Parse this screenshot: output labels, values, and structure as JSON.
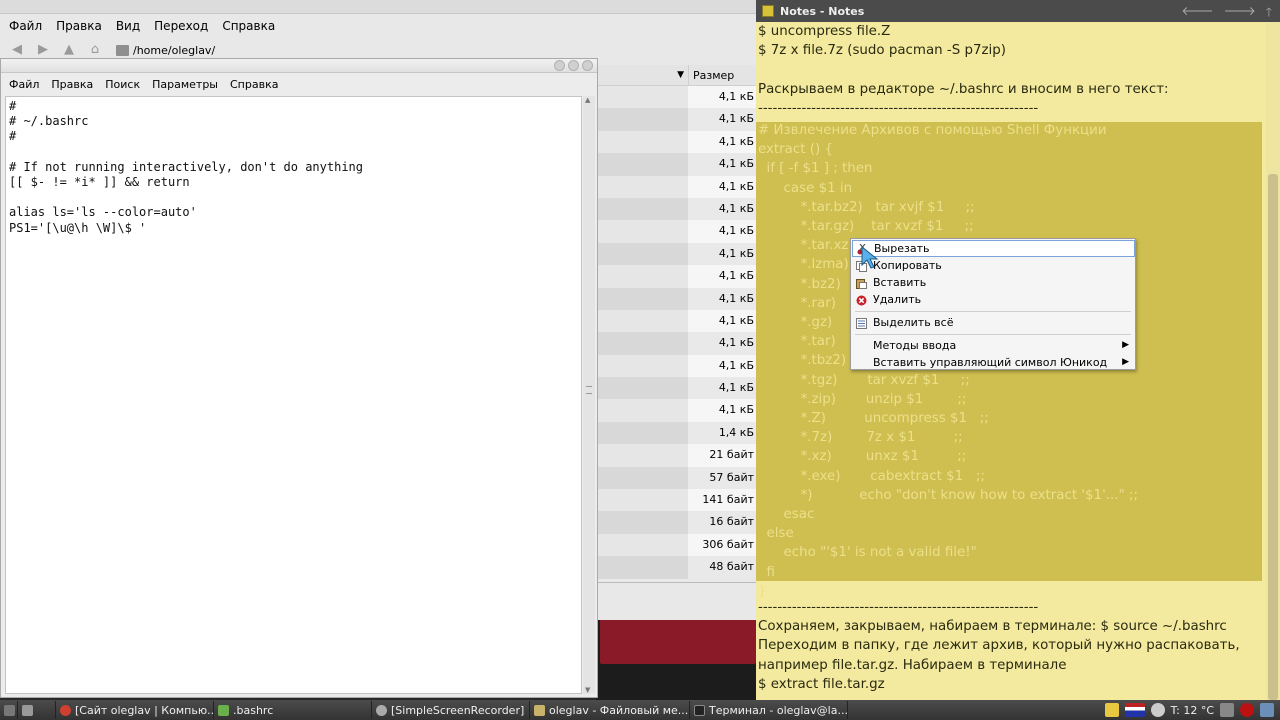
{
  "file_manager": {
    "menu": [
      "Файл",
      "Правка",
      "Вид",
      "Переход",
      "Справка"
    ],
    "path": "/home/oleglav/",
    "size_header": "Размер",
    "sizes": [
      "4,1 кБ",
      "4,1 кБ",
      "4,1 кБ",
      "4,1 кБ",
      "4,1 кБ",
      "4,1 кБ",
      "4,1 кБ",
      "4,1 кБ",
      "4,1 кБ",
      "4,1 кБ",
      "4,1 кБ",
      "4,1 кБ",
      "4,1 кБ",
      "4,1 кБ",
      "4,1 кБ",
      "1,4 кБ",
      "21 байт",
      "57 байт",
      "141 байт",
      "16 байт",
      "306 байт",
      "48 байт"
    ]
  },
  "editor": {
    "menu": [
      "Файл",
      "Правка",
      "Поиск",
      "Параметры",
      "Справка"
    ],
    "content": "#\n# ~/.bashrc\n#\n\n# If not running interactively, don't do anything\n[[ $- != *i* ]] && return\n\nalias ls='ls --color=auto'\nPS1='[\\u@\\h \\W]\\$ '"
  },
  "notes": {
    "title": "Notes - Notes",
    "lines_before": [
      "$ uncompress file.Z",
      "$ 7z x file.7z (sudo pacman -S p7zip)",
      "",
      "Раскрываем в редакторе ~/.bashrc и вносим в него текст:",
      "----------------------------------------------------------"
    ],
    "selected_lines": [
      "# Извлечение Архивов с помощью Shell Функции",
      "extract () {",
      "  if [ -f $1 ] ; then",
      "      case $1 in",
      "          *.tar.bz2)   tar xvjf $1     ;;",
      "          *.tar.gz)    tar xvzf $1     ;;",
      "          *.tar.xz)    tar xvJf $1     ;;",
      "          *.lzma)      unlzma $1       ;;",
      "          *.bz2)       bunzip2 $1      ;;",
      "          *.rar)       unrar x $1      ;;",
      "          *.gz)        gunzip $1       ;;",
      "          *.tar)       tar xvf $1      ;;",
      "          *.tbz2)      tar xvjf $1     ;;",
      "          *.tgz)       tar xvzf $1     ;;",
      "          *.zip)       unzip $1        ;;",
      "          *.Z)         uncompress $1   ;;",
      "          *.7z)        7z x $1         ;;",
      "          *.xz)        unxz $1         ;;",
      "          *.exe)       cabextract $1   ;;",
      "          *)           echo \"don't know how to extract '$1'...\" ;;",
      "      esac",
      "  else",
      "      echo \"'$1' is not a valid file!\"",
      "  fi",
      "}"
    ],
    "lines_after": [
      "----------------------------------------------------------",
      "Сохраняем, закрываем, набираем в терминале: $ source ~/.bashrc",
      "Переходим в папку, где лежит архив, который нужно распаковать,",
      "например file.tar.gz. Набираем в терминале",
      "$ extract file.tar.gz"
    ]
  },
  "context_menu": {
    "cut": "Вырезать",
    "copy": "Копировать",
    "paste": "Вставить",
    "delete": "Удалить",
    "select_all": "Выделить всё",
    "input_methods": "Методы ввода",
    "insert_unicode": "Вставить управляющий символ Юникод"
  },
  "taskbar": {
    "tasks": [
      "[Сайт oleglav | Компью...",
      ".bashrc",
      "[SimpleScreenRecorder]",
      "oleglav - Файловый ме...",
      "Терминал - oleglav@la..."
    ],
    "temperature": "T: 12 °C"
  },
  "colors": {
    "notes_bg": "#f3eaa0",
    "notes_selection": "#cfbe50",
    "menu_highlight_border": "#7aa3d6"
  }
}
